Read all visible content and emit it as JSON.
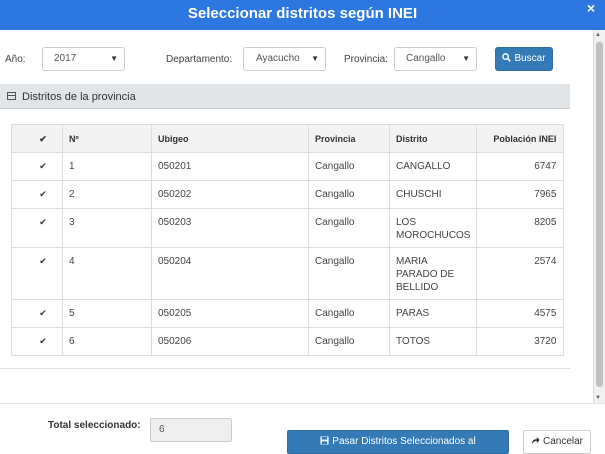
{
  "window": {
    "title": "Seleccionar distritos según INEI",
    "close_glyph": "×"
  },
  "filters": {
    "year_label": "Año:",
    "year_value": "2017",
    "department_label": "Departamento:",
    "department_value": "Ayacucho",
    "province_label": "Provincia:",
    "province_value": "Cangallo",
    "search_label": "Buscar",
    "search_icon": "search-icon"
  },
  "panel": {
    "heading": "Distritos de la provincia",
    "heading_icon": "table-icon"
  },
  "table": {
    "headers": [
      "✔",
      "Nº",
      "Ubigeo",
      "Provincia",
      "Distrito",
      "Población INEI"
    ],
    "rows": [
      {
        "checked": "✔",
        "n": "1",
        "ubigeo": "050201",
        "provincia": "Cangallo",
        "distrito": "CANGALLO",
        "poblacion": "6747"
      },
      {
        "checked": "✔",
        "n": "2",
        "ubigeo": "050202",
        "provincia": "Cangallo",
        "distrito": "CHUSCHI",
        "poblacion": "7965"
      },
      {
        "checked": "✔",
        "n": "3",
        "ubigeo": "050203",
        "provincia": "Cangallo",
        "distrito": "LOS MOROCHUCOS",
        "poblacion": "8205"
      },
      {
        "checked": "✔",
        "n": "4",
        "ubigeo": "050204",
        "provincia": "Cangallo",
        "distrito": "MARIA PARADO DE BELLIDO",
        "poblacion": "2574"
      },
      {
        "checked": "✔",
        "n": "5",
        "ubigeo": "050205",
        "provincia": "Cangallo",
        "distrito": "PARAS",
        "poblacion": "4575"
      },
      {
        "checked": "✔",
        "n": "6",
        "ubigeo": "050206",
        "provincia": "Cangallo",
        "distrito": "TOTOS",
        "poblacion": "3720"
      }
    ]
  },
  "footer": {
    "total_label": "Total seleccionado:",
    "total_value": "6",
    "submit_label": "Pasar Distritos Seleccionados al Requerimiento",
    "submit_icon": "save-icon",
    "cancel_label": "Cancelar",
    "cancel_icon": "share-icon"
  },
  "colors": {
    "titlebar": "#2c77e0",
    "primary_button": "#337ab7",
    "panel_heading": "#e2e5e8"
  }
}
